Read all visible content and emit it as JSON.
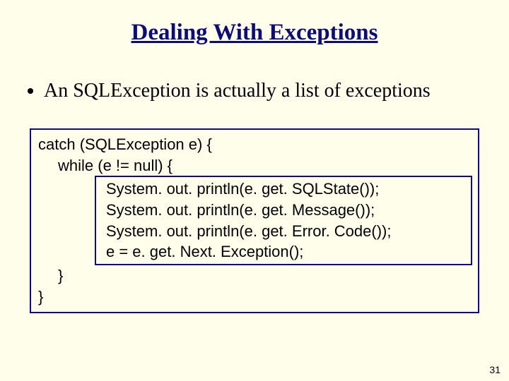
{
  "title": "Dealing With Exceptions",
  "bullet": "An SQLException is actually a list of exceptions",
  "code": {
    "l1": "catch (SQLException e) {",
    "l2": "while (e != null) {",
    "l3": "System. out. println(e. get. SQLState());",
    "l4": "System. out. println(e. get. Message());",
    "l5": "System. out. println(e. get. Error. Code());",
    "l6": "e = e. get. Next. Exception();",
    "l7": "}",
    "l8": "}"
  },
  "page_number": "31"
}
